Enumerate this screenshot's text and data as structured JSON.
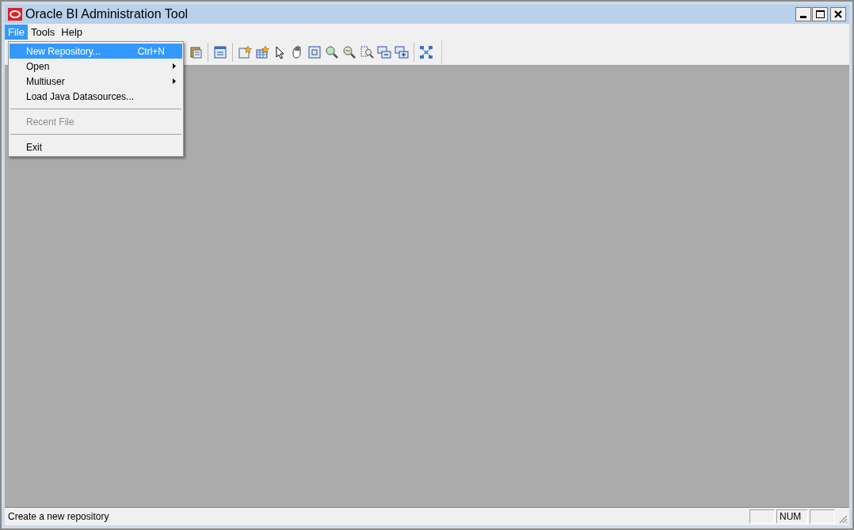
{
  "window": {
    "title": "Oracle BI Administration Tool"
  },
  "menu_bar": [
    {
      "label": "File",
      "selected": true
    },
    {
      "label": "Tools",
      "selected": false
    },
    {
      "label": "Help",
      "selected": false
    }
  ],
  "file_menu": [
    {
      "kind": "item",
      "label": "New Repository...",
      "shortcut": "Ctrl+N",
      "submenu": false,
      "disabled": false,
      "selected": true
    },
    {
      "kind": "item",
      "label": "Open",
      "submenu": true,
      "disabled": false,
      "selected": false
    },
    {
      "kind": "item",
      "label": "Multiuser",
      "submenu": true,
      "disabled": false,
      "selected": false
    },
    {
      "kind": "item",
      "label": "Load Java Datasources...",
      "submenu": false,
      "disabled": false,
      "selected": false
    },
    {
      "kind": "separator"
    },
    {
      "kind": "item",
      "label": "Recent File",
      "submenu": false,
      "disabled": true,
      "selected": false
    },
    {
      "kind": "separator"
    },
    {
      "kind": "item",
      "label": "Exit",
      "submenu": false,
      "disabled": false,
      "selected": false
    }
  ],
  "status_bar": {
    "message": "Create a new repository",
    "indicator": "NUM"
  }
}
